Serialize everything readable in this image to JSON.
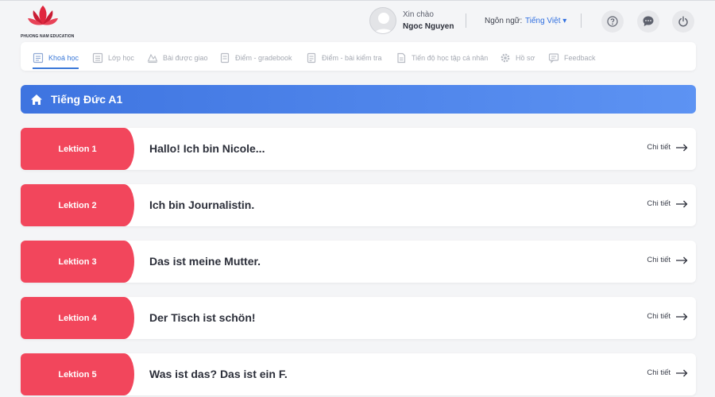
{
  "header": {
    "logo_text": "PHUONG NAM EDUCATION",
    "greeting": "Xin chào",
    "username": "Ngoc Nguyen",
    "language_label": "Ngôn ngữ:",
    "language_value": "Tiếng Việt ▾"
  },
  "nav": {
    "items": [
      {
        "label": "Khoá học",
        "icon": "book-icon",
        "active": true
      },
      {
        "label": "Lớp học",
        "icon": "class-icon",
        "active": false
      },
      {
        "label": "Bài được giao",
        "icon": "assignment-icon",
        "active": false
      },
      {
        "label": "Điểm - gradebook",
        "icon": "gradebook-icon",
        "active": false
      },
      {
        "label": "Điểm - bài kiểm tra",
        "icon": "test-score-icon",
        "active": false
      },
      {
        "label": "Tiến độ học tập cá nhân",
        "icon": "progress-icon",
        "active": false
      },
      {
        "label": "Hồ sơ",
        "icon": "gear-icon",
        "active": false
      },
      {
        "label": "Feedback",
        "icon": "feedback-icon",
        "active": false
      }
    ]
  },
  "course": {
    "title": "Tiếng Đức A1"
  },
  "lessons": [
    {
      "label": "Lektion 1",
      "title": "Hallo! Ich bin Nicole...",
      "detail": "Chi tiết"
    },
    {
      "label": "Lektion 2",
      "title": "Ich bin Journalistin.",
      "detail": "Chi tiết"
    },
    {
      "label": "Lektion 3",
      "title": "Das ist meine Mutter.",
      "detail": "Chi tiết"
    },
    {
      "label": "Lektion 4",
      "title": "Der Tisch ist schön!",
      "detail": "Chi tiết"
    },
    {
      "label": "Lektion 5",
      "title": "Was ist das? Das ist ein F.",
      "detail": "Chi tiết"
    }
  ],
  "colors": {
    "accent_blue": "#3a78d8",
    "lesson_red": "#f2465c",
    "banner_start": "#3e74e0",
    "banner_end": "#5d93f3"
  }
}
